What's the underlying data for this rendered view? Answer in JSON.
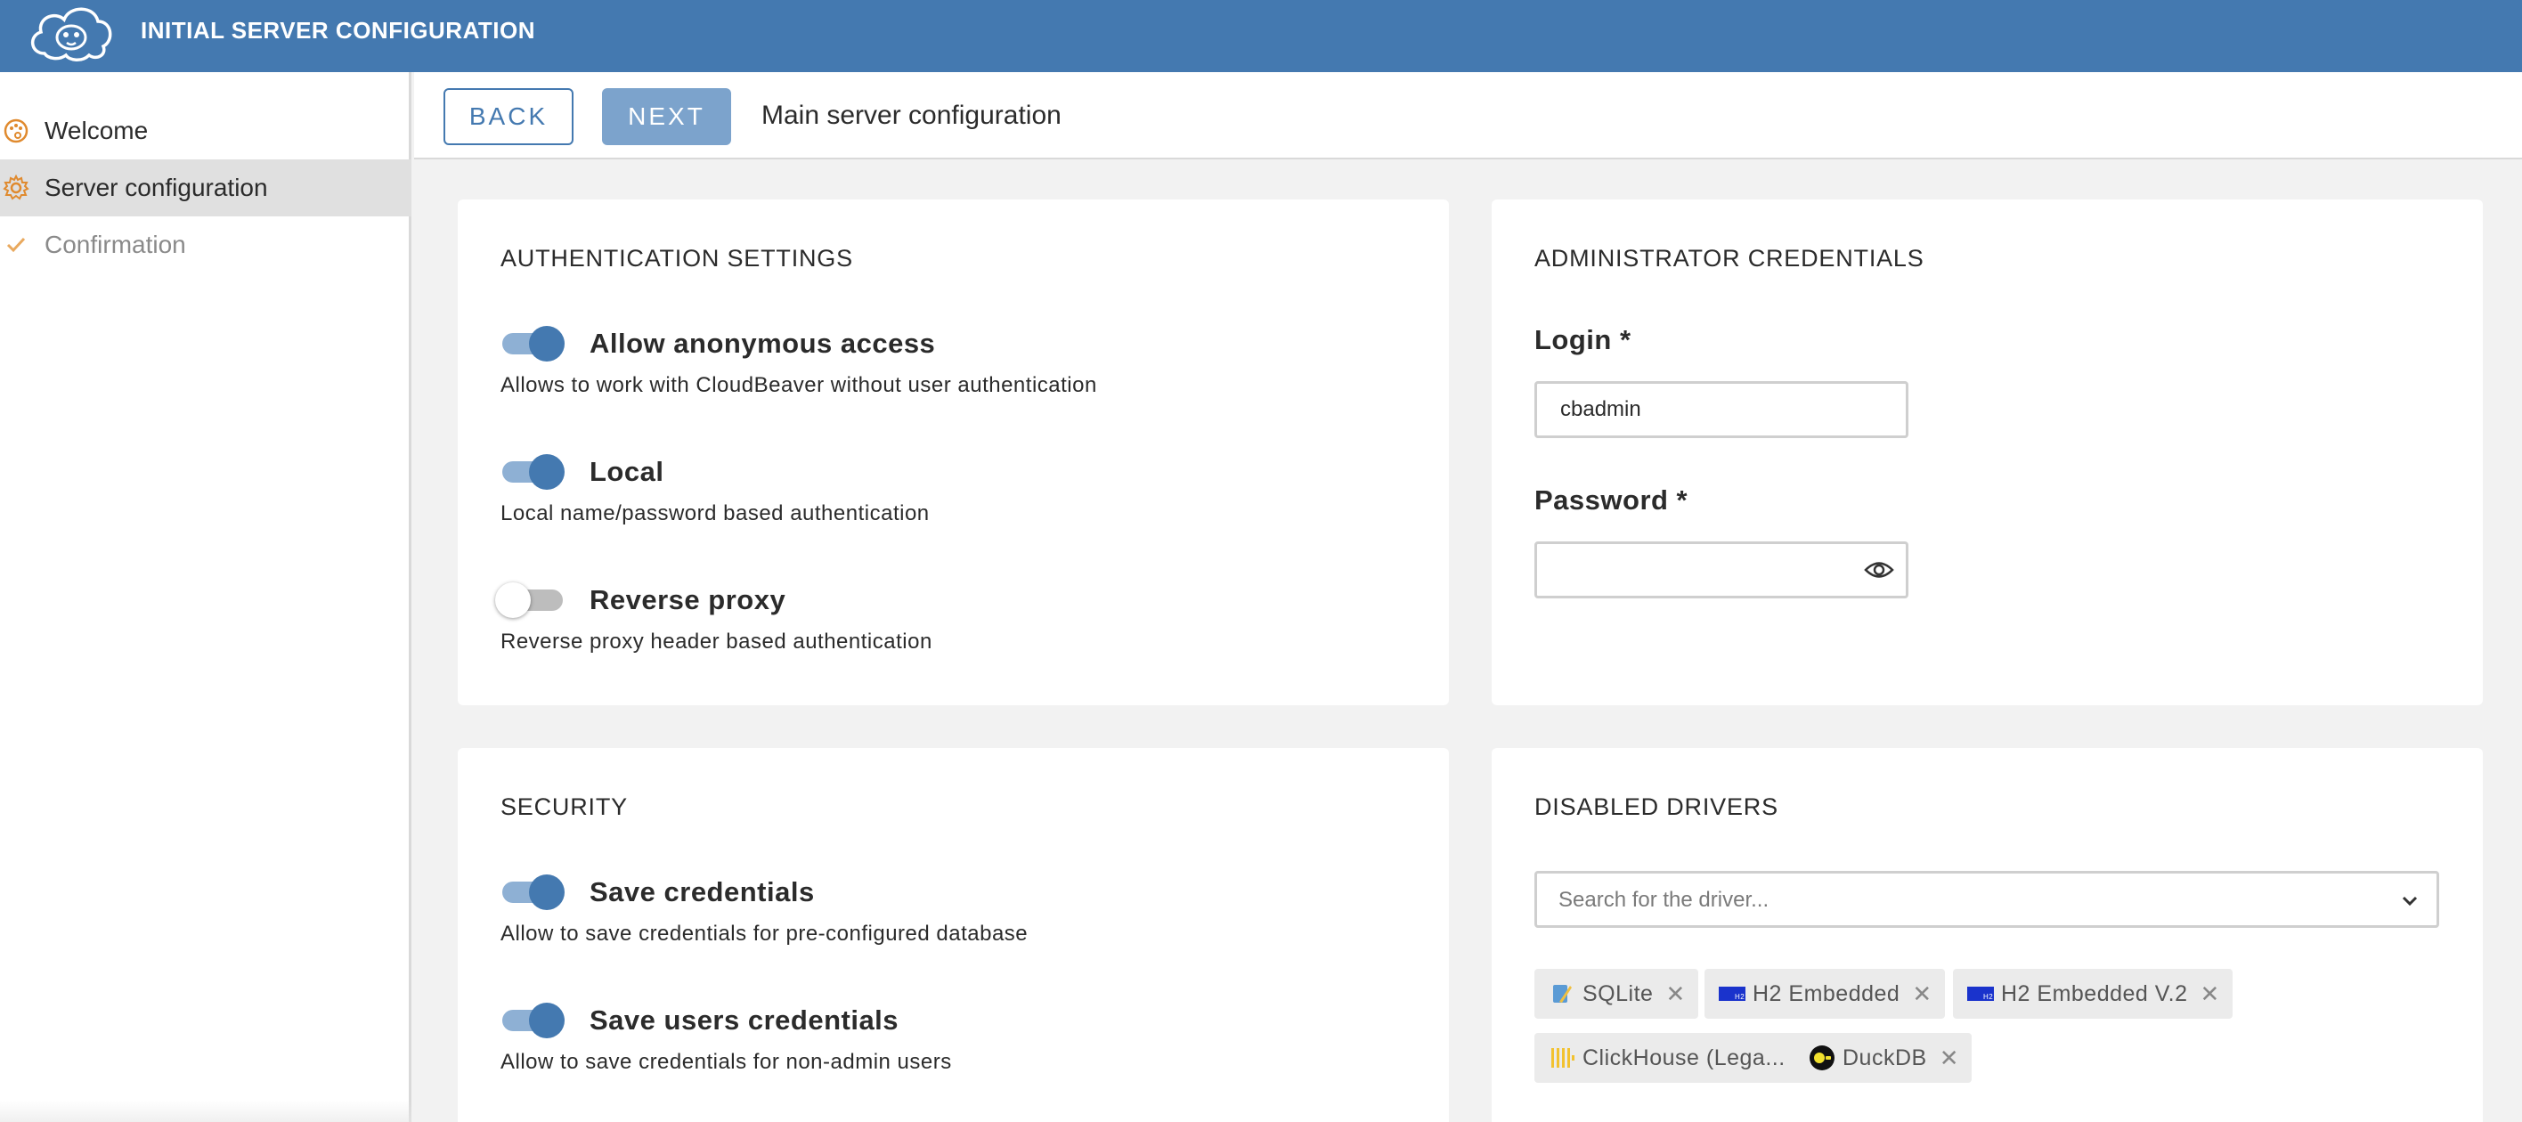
{
  "header": {
    "title": "INITIAL SERVER CONFIGURATION"
  },
  "colors": {
    "brand": "#4479b0",
    "sidebar_icon": "#e08a2e"
  },
  "sidebar": {
    "items": [
      {
        "label": "Welcome",
        "icon": "palette-icon",
        "state": "default"
      },
      {
        "label": "Server configuration",
        "icon": "gear-icon",
        "state": "active"
      },
      {
        "label": "Confirmation",
        "icon": "check-icon",
        "state": "disabled"
      }
    ]
  },
  "toolbar": {
    "back_label": "BACK",
    "next_label": "NEXT",
    "title": "Main server configuration"
  },
  "auth": {
    "title": "AUTHENTICATION SETTINGS",
    "options": [
      {
        "label": "Allow anonymous access",
        "description": "Allows to work with CloudBeaver without user authentication",
        "enabled": true
      },
      {
        "label": "Local",
        "description": "Local name/password based authentication",
        "enabled": true
      },
      {
        "label": "Reverse proxy",
        "description": "Reverse proxy header based authentication",
        "enabled": false
      }
    ]
  },
  "admin": {
    "title": "ADMINISTRATOR CREDENTIALS",
    "login_label": "Login *",
    "login_value": "cbadmin",
    "password_label": "Password *",
    "password_value": ""
  },
  "security": {
    "title": "SECURITY",
    "options": [
      {
        "label": "Save credentials",
        "description": "Allow to save credentials for pre-configured database",
        "enabled": true
      },
      {
        "label": "Save users credentials",
        "description": "Allow to save credentials for non-admin users",
        "enabled": true
      }
    ]
  },
  "drivers": {
    "title": "DISABLED DRIVERS",
    "search_placeholder": "Search for the driver...",
    "chips": [
      {
        "label": "SQLite",
        "icon": "sqlite-icon"
      },
      {
        "label": "H2 Embedded",
        "icon": "h2-icon"
      },
      {
        "label": "H2 Embedded V.2",
        "icon": "h2-icon"
      },
      {
        "label": "ClickHouse (Lega...",
        "icon": "clickhouse-icon"
      },
      {
        "label": "DuckDB",
        "icon": "duckdb-icon"
      }
    ]
  }
}
